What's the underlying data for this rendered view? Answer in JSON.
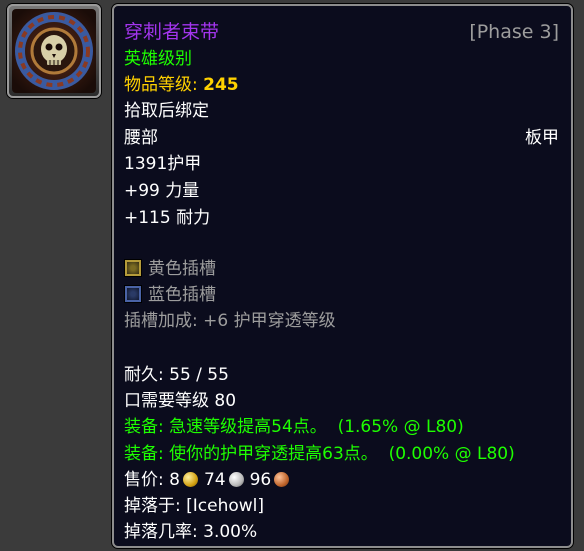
{
  "item": {
    "name": "穿刺者束带",
    "phase": "[Phase 3]",
    "quality": "英雄级别",
    "item_level_label": "物品等级: ",
    "item_level_value": "245",
    "bind": "拾取后绑定",
    "slot": "腰部",
    "armor_type": "板甲",
    "armor": "1391护甲",
    "stats": [
      "+99 力量",
      "+115 耐力"
    ],
    "sockets": [
      {
        "color": "yellow",
        "label": "黄色插槽"
      },
      {
        "color": "blue",
        "label": "蓝色插槽"
      }
    ],
    "socket_bonus": "插槽加成: +6 护甲穿透等级",
    "durability": "耐久: 55 / 55",
    "required_level": "口需要等级 80",
    "equip_effects": [
      {
        "text": "装备: 急速等级提高54点。",
        "note": "(1.65% @ L80)"
      },
      {
        "text": "装备: 使你的护甲穿透提高63点。",
        "note": "(0.00% @ L80)"
      }
    ],
    "sell_price": {
      "label": "售价: ",
      "gold": "8",
      "silver": "74",
      "copper": "96"
    },
    "drop_from": "掉落于: [Icehowl]",
    "drop_rate": "掉落几率: 3.00%"
  },
  "colors": {
    "epic_purple": "#a335ee",
    "uncommon_green": "#1eff00",
    "item_level_yellow": "#ffd100",
    "gray": "#9d9d9d",
    "tooltip_bg": "#0b0c1d"
  },
  "icon": {
    "name": "skull-belt-icon"
  }
}
